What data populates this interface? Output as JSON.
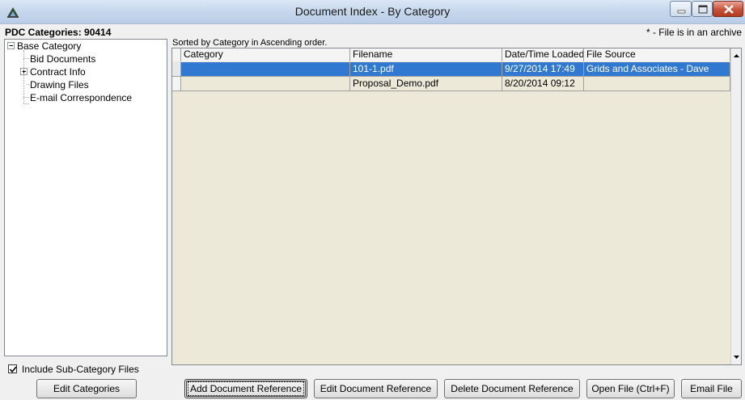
{
  "window": {
    "title": "Document Index - By Category"
  },
  "header": {
    "pdc_label": "PDC Categories: 90414",
    "archive_note": "* - File is in an archive",
    "sorted_label": "Sorted by Category in Ascending order."
  },
  "tree": {
    "root": "Base Category",
    "items": [
      "Bid Documents",
      "Contract Info",
      "Drawing Files",
      "E-mail Correspondence"
    ]
  },
  "grid": {
    "columns": [
      "Category",
      "Filename",
      "Date/Time Loaded",
      "File Source"
    ],
    "rows": [
      {
        "category": "",
        "filename": "101-1.pdf",
        "loaded": "9/27/2014 17:49",
        "source": "Grids and Associates - Dave",
        "selected": true
      },
      {
        "category": "",
        "filename": "Proposal_Demo.pdf",
        "loaded": "8/20/2014 09:12",
        "source": "",
        "selected": false
      }
    ]
  },
  "options": {
    "include_sub_label": "Include Sub-Category Files",
    "include_sub_checked": true
  },
  "buttons": {
    "edit_categories": "Edit Categories",
    "add_ref": "Add Document Reference",
    "edit_ref": "Edit Document Reference",
    "delete_ref": "Delete Document Reference",
    "open_file": "Open File (Ctrl+F)",
    "email_file": "Email File"
  },
  "colors": {
    "selection": "#3178d0",
    "grid_background": "#ece9d8",
    "close_button": "#c7513b"
  }
}
